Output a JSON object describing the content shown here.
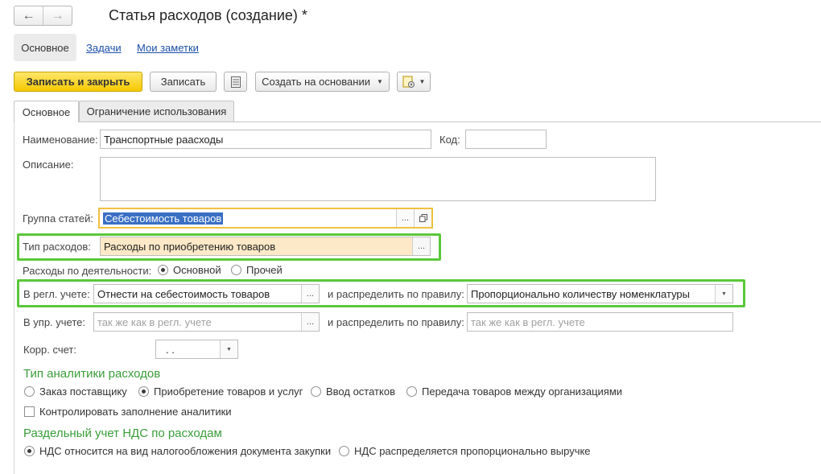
{
  "header": {
    "back_icon": "arrow-left-icon",
    "forward_icon": "arrow-right-icon",
    "title": "Статья расходов (создание) *"
  },
  "sections": {
    "main": "Основное",
    "tasks": "Задачи",
    "notes": "Мои заметки"
  },
  "toolbar": {
    "save_close": "Записать и закрыть",
    "save": "Записать",
    "create_based": "Создать на основании",
    "report_icon": "document-list-icon",
    "doc_settings_icon": "document-gear-icon"
  },
  "tabs": {
    "main": "Основное",
    "restrictions": "Ограничение использования"
  },
  "form": {
    "name_label": "Наименование:",
    "name_value": "Транспортные раасходы",
    "code_label": "Код:",
    "code_value": "",
    "description_label": "Описание:",
    "description_value": "",
    "group_label": "Группа статей:",
    "group_value": "Себестоимость товаров",
    "type_label": "Тип расходов:",
    "type_value": "Расходы по приобретению товаров",
    "activity_label": "Расходы по деятельности:",
    "activity_main": "Основной",
    "activity_other": "Прочей",
    "reg_label": "В регл. учете:",
    "reg_value": "Отнести на себестоимость товаров",
    "distribute_label": "и распределить по правилу:",
    "reg_rule_value": "Пропорционально количеству номенклатуры",
    "mgmt_label": "В упр. учете:",
    "mgmt_placeholder": "так же как в регл. учете",
    "mgmt_rule_placeholder": "так же как в регл. учете",
    "account_label": "Корр. счет:",
    "account_value": ".  ."
  },
  "analytics": {
    "title": "Тип аналитики расходов",
    "opt1": "Заказ поставщику",
    "opt2": "Приобретение товаров и услуг",
    "opt3": "Ввод остатков",
    "opt4": "Передача товаров между организациями",
    "control_label": "Контролировать заполнение аналитики"
  },
  "vat": {
    "title": "Раздельный учет НДС по расходам",
    "opt1": "НДС относится на вид налогообложения документа закупки",
    "opt2": "НДС распределяется пропорционально выручке"
  },
  "colors": {
    "accent_green": "#5ac83a",
    "section_green": "#3a9d3a",
    "primary_yellow": "#f5c900",
    "highlight_field": "#fde9c7",
    "selection_blue": "#3a6fc4"
  }
}
